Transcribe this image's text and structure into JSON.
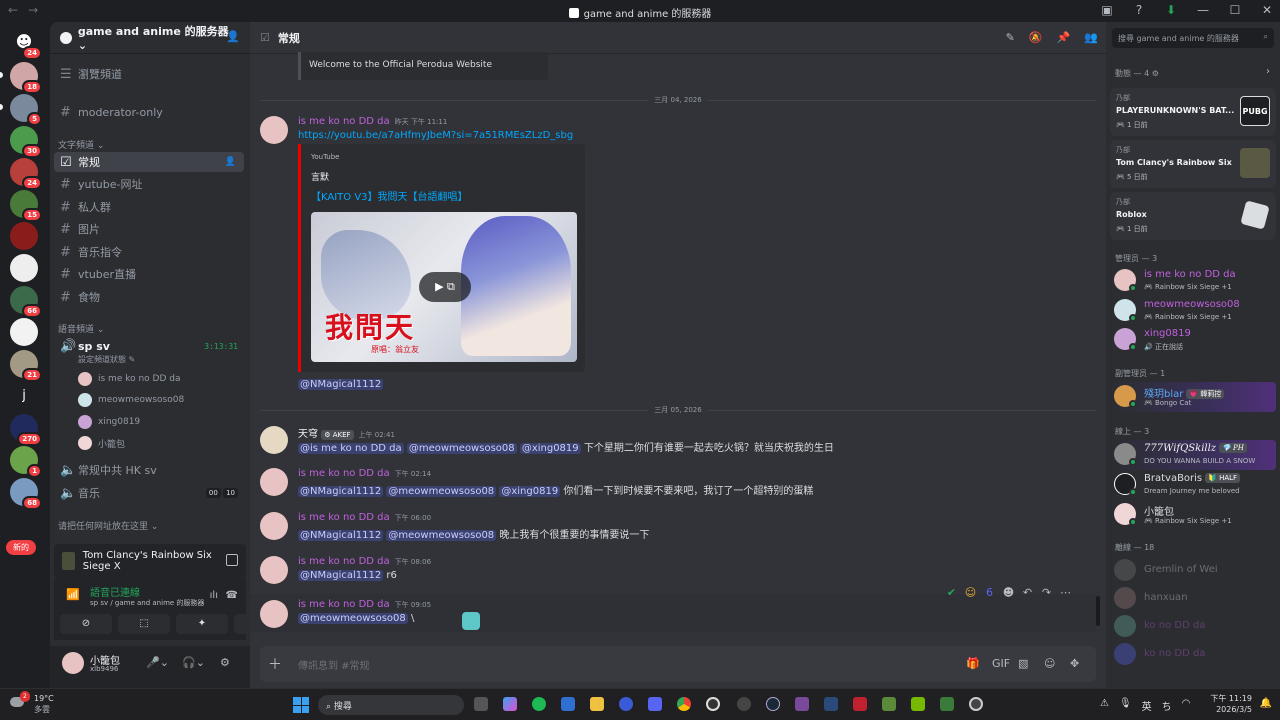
{
  "window": {
    "title": "game and anime 的服務器",
    "back": "←",
    "forward": "→",
    "controls": [
      "▣",
      "?",
      "⬇",
      "—",
      "☐",
      "✕"
    ]
  },
  "rail": {
    "badges": [
      "24",
      "18",
      "5",
      "30",
      "24",
      "15",
      "66",
      "21",
      "270",
      "1",
      "68"
    ],
    "server_j": "j",
    "new_pill": "新的"
  },
  "sidebar": {
    "server_name": "game and anime 的服务器 ⌄",
    "browse": "瀏覽頻道",
    "moderator": "moderator-only",
    "cat_text": "文字頻道 ⌄",
    "channels": {
      "general": "常规",
      "yutube": "yutube-网址",
      "private": "私人群",
      "pics": "图片",
      "music_cmd": "音乐指令",
      "vtuber": "vtuber直播",
      "food": "食物"
    },
    "cat_voice": "語音頻道 ⌄",
    "voice_channel": "sp sv",
    "voice_timer": "3:13:31",
    "voice_status": "設定頻道狀態 ✎",
    "voice_users": [
      "is me ko no DD da",
      "meowmeowsoso08",
      "xing0819",
      "小籠包"
    ],
    "hk": "常规中共 HK sv",
    "music": "音乐",
    "music_count_a": "00",
    "music_count_b": "10",
    "cat_link": "请把任何网址放在这里 ⌄"
  },
  "game_bar": {
    "name": "Tom Clancy's Rainbow Six Siege X"
  },
  "voice_panel": {
    "title": "語音已連線",
    "sub": "sp sv / game and anime 的服務器"
  },
  "user_panel": {
    "name": "小籠包",
    "tag": "xlb9496"
  },
  "chat": {
    "channel": "常规",
    "embed_top": "Welcome to the Official Perodua Website",
    "date1": "三月 04, 2026",
    "m1": {
      "author": "is me ko no DD da",
      "time": "昨天 下午 11:11",
      "link": "https://youtu.be/a7aHfmyJbeM?si=7a51RMEsZLzD_sbg"
    },
    "yt": {
      "provider": "YouTube",
      "channel": "言默",
      "title": "【KAITO V3】我問天【台語翻唱】",
      "kanji": "我問天",
      "credit": "原唱：翁立友"
    },
    "m1_mention": "@NMagical1112",
    "date2": "三月 05, 2026",
    "m2": {
      "author": "天穹",
      "tag": "⚙ AKEF",
      "time": "上午 02:41",
      "mentions": [
        "@is me ko no DD da",
        "@meowmeowsoso08",
        "@xing0819"
      ],
      "text": "下个星期二你们有谁要一起去吃火锅？就当庆祝我的生日"
    },
    "m3": {
      "author": "is me ko no DD da",
      "time": "下午 02:14",
      "mentions": [
        "@NMagical1112",
        "@meowmeowsoso08",
        "@xing0819"
      ],
      "text": "你们看一下到时候要不要来吧，我订了一个超特别的蛋糕"
    },
    "m4": {
      "author": "is me ko no DD da",
      "time": "下午 06:00",
      "mentions": [
        "@NMagical1112",
        "@meowmeowsoso08"
      ],
      "text": "晚上我有个很重要的事情要说一下"
    },
    "m5": {
      "author": "is me ko no DD da",
      "time": "下午 08:06",
      "mention": "@NMagical1112",
      "text": "r6"
    },
    "m6": {
      "author": "is me ko no DD da",
      "time": "下午 09:05",
      "mention": "@meowmeowsoso08",
      "text": "\\"
    },
    "react_count": "6",
    "composer_placeholder": "傳訊息到 #常规"
  },
  "members": {
    "search_placeholder": "搜尋 game and anime 的服務器",
    "activity_header": "動態 — 4 ⚙",
    "activities": [
      {
        "who": "乃部",
        "game": "PLAYERUNKNOWN'S BAT...",
        "since": "🎮 1 日前",
        "art": "PUBG"
      },
      {
        "who": "乃部",
        "game": "Tom Clancy's Rainbow Six ...",
        "since": "🎮 5 日前"
      },
      {
        "who": "乃部",
        "game": "Roblox",
        "since": "🎮 1 日前"
      }
    ],
    "admin_header": "管理员 — 3",
    "admins": [
      {
        "name": "is me ko no DD da",
        "status": "🎮 Rainbow Six Siege +1"
      },
      {
        "name": "meowmeowsoso08",
        "status": "🎮 Rainbow Six Siege +1"
      },
      {
        "name": "xing0819",
        "status": "🔊 正在說話"
      }
    ],
    "vice_header": "副管理员 — 1",
    "vice": {
      "name": "殘玥blar",
      "tag": "💗 韓莉控",
      "status": "🎮 Bongo Cat"
    },
    "online_header": "線上 — 3",
    "online": [
      {
        "name": "777WifQSkillz",
        "tag": "💎 PH",
        "status": "DO YOU WANNA BUILD A SNOW"
      },
      {
        "name": "BratvaBoris",
        "tag": "🔰 HALF",
        "status": "Dream Journey me beloved"
      },
      {
        "name": "小籠包",
        "status": "🎮 Rainbow Six Siege +1"
      }
    ],
    "offline_header": "離線 — 18",
    "offline": [
      "Gremlin of Wei",
      "hanxuan",
      "ko no DD da",
      "ko no DD da"
    ]
  },
  "taskbar": {
    "temp": "19°C",
    "weather": "多雲",
    "weather_badge": "2",
    "search": "搜尋",
    "lang": "英",
    "time": "下午 11:19",
    "date": "2026/3/5"
  }
}
